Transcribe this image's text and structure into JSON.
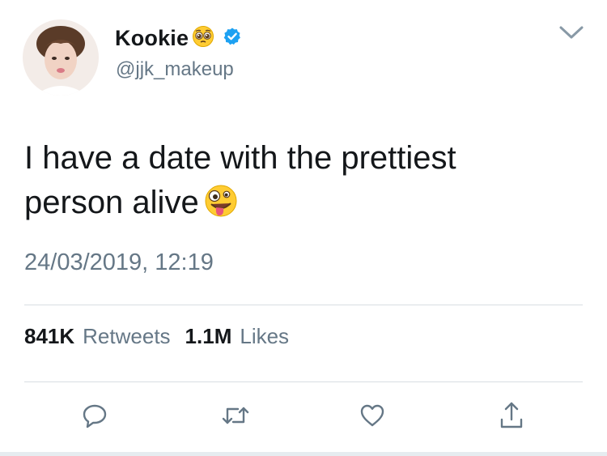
{
  "author": {
    "display_name": "Kookie",
    "name_emoji": "pleading-face-emoji",
    "verified": true,
    "handle": "@jjk_makeup"
  },
  "tweet": {
    "text_line1": "I have a date with the prettiest",
    "text_line2": "person alive",
    "text_emoji": "zany-face-emoji",
    "timestamp": "24/03/2019, 12:19"
  },
  "stats": {
    "retweets_count": "841K",
    "retweets_label": "Retweets",
    "likes_count": "1.1M",
    "likes_label": "Likes"
  },
  "actions": [
    "reply-icon",
    "retweet-icon",
    "like-icon",
    "share-icon"
  ],
  "colors": {
    "text": "#14171a",
    "secondary": "#657786",
    "verified": "#1da1f2",
    "divider": "#d8dde2"
  }
}
